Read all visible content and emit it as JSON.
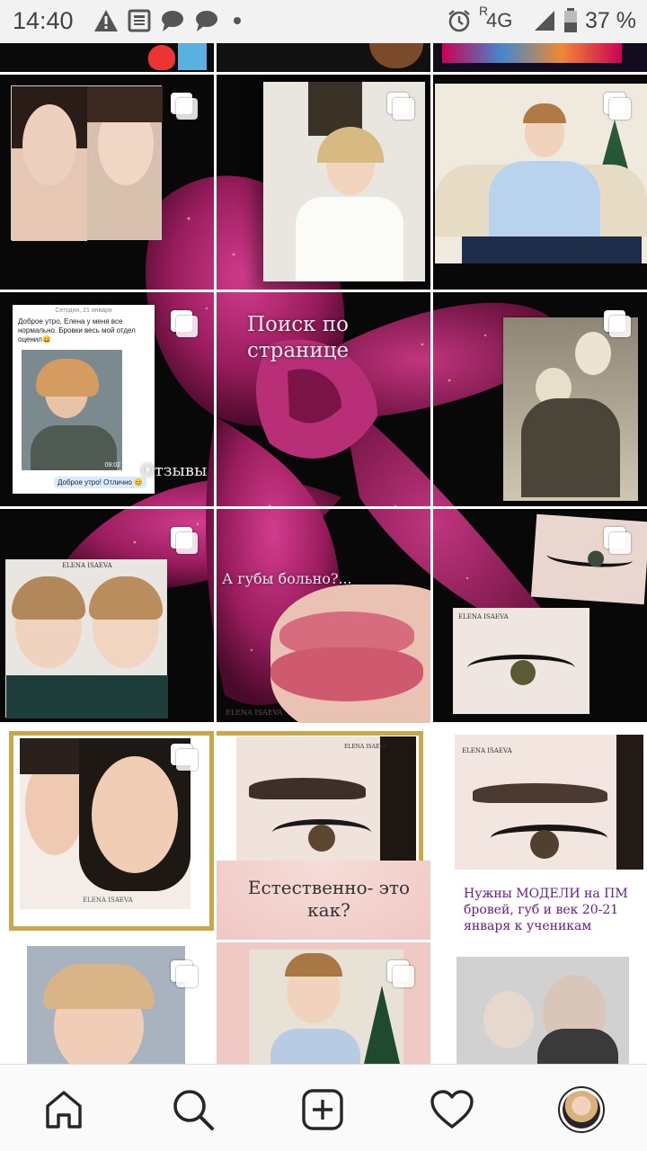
{
  "status_bar": {
    "time": "14:40",
    "network": "4G",
    "roaming": "R",
    "battery": "37 %",
    "left_icons": [
      "warning-icon",
      "news-icon",
      "chat-icon",
      "chat-icon",
      "dot-icon"
    ],
    "right_icons": [
      "alarm-icon",
      "signal-icon",
      "battery-icon"
    ]
  },
  "grid": {
    "tiles": [
      {
        "id": "r1c1",
        "overlay": "",
        "multi": true
      },
      {
        "id": "r1c2",
        "overlay": "",
        "multi": true
      },
      {
        "id": "r1c3",
        "overlay": "",
        "multi": true
      },
      {
        "id": "r2c1",
        "overlay": "Отзывы",
        "multi": true,
        "chat": {
          "date": "Сегодня, 21 января",
          "message": "Доброе утро, Елена у меня все нормально. Бровки весь мой отдел оценил😀",
          "time": "09:02",
          "reply": "Доброе утро! Отлично 😊"
        }
      },
      {
        "id": "r2c2",
        "overlay": "Поиск по странице",
        "multi": false
      },
      {
        "id": "r2c3",
        "overlay": "",
        "multi": true
      },
      {
        "id": "r3c1",
        "overlay": "",
        "multi": true,
        "brand": "ELENA ISAEVA"
      },
      {
        "id": "r3c2",
        "overlay": "А губы больно?...",
        "multi": false,
        "brand": "ELENA ISAEVA"
      },
      {
        "id": "r3c3",
        "overlay": "",
        "multi": true,
        "brand": "ELENA ISAEVA"
      },
      {
        "id": "r4c1",
        "overlay": "",
        "multi": true,
        "brand": "ELENA ISAEVA"
      },
      {
        "id": "r4c2",
        "overlay": "Естественно- это как?",
        "multi": false,
        "brand": "ELENA ISAEVA"
      },
      {
        "id": "r4c3",
        "overlay": "Нужны МОДЕЛИ на ПМ бровей, губ и век 20-21 января к ученикам",
        "multi": false,
        "brand": "ELENA ISAEVA"
      },
      {
        "id": "r5c1",
        "overlay": "",
        "multi": true
      },
      {
        "id": "r5c2",
        "overlay": "",
        "multi": true
      },
      {
        "id": "r5c3",
        "overlay": "",
        "multi": false
      }
    ]
  },
  "bottom_nav": {
    "items": [
      {
        "name": "home",
        "icon": "home-icon"
      },
      {
        "name": "search",
        "icon": "search-icon"
      },
      {
        "name": "new-post",
        "icon": "plus-square-icon"
      },
      {
        "name": "activity",
        "icon": "heart-icon"
      },
      {
        "name": "profile",
        "icon": "avatar"
      }
    ]
  },
  "colors": {
    "magenta": "#8e1b5a",
    "rose_light": "#c23a86",
    "dark_bg": "#0c0c0c",
    "gold": "#c9a84a",
    "nav_bg": "#fafafa",
    "status_bg": "#f2f2f2"
  }
}
